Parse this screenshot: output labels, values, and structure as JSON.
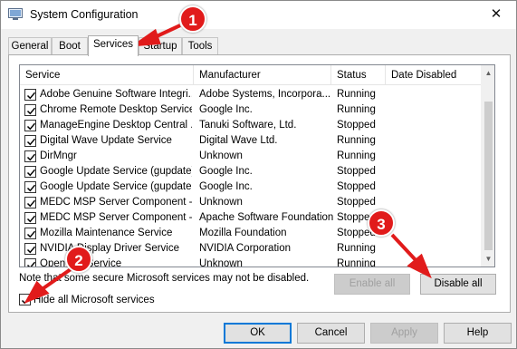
{
  "window": {
    "title": "System Configuration",
    "close_glyph": "✕"
  },
  "tabs": [
    {
      "label": "General"
    },
    {
      "label": "Boot"
    },
    {
      "label": "Services"
    },
    {
      "label": "Startup"
    },
    {
      "label": "Tools"
    }
  ],
  "active_tab": "Services",
  "columns": [
    "Service",
    "Manufacturer",
    "Status",
    "Date Disabled"
  ],
  "services": [
    {
      "name": "Adobe Genuine Software Integri...",
      "manufacturer": "Adobe Systems, Incorpora...",
      "status": "Running",
      "checked": true
    },
    {
      "name": "Chrome Remote Desktop Service",
      "manufacturer": "Google Inc.",
      "status": "Running",
      "checked": true
    },
    {
      "name": "ManageEngine Desktop Central ...",
      "manufacturer": "Tanuki Software, Ltd.",
      "status": "Stopped",
      "checked": true
    },
    {
      "name": "Digital Wave Update Service",
      "manufacturer": "Digital Wave Ltd.",
      "status": "Running",
      "checked": true
    },
    {
      "name": "DirMngr",
      "manufacturer": "Unknown",
      "status": "Running",
      "checked": true
    },
    {
      "name": "Google Update Service (gupdate)",
      "manufacturer": "Google Inc.",
      "status": "Stopped",
      "checked": true
    },
    {
      "name": "Google Update Service (gupdatem)",
      "manufacturer": "Google Inc.",
      "status": "Stopped",
      "checked": true
    },
    {
      "name": "MEDC MSP Server Component - ...",
      "manufacturer": "Unknown",
      "status": "Stopped",
      "checked": true
    },
    {
      "name": "MEDC MSP Server Component - ...",
      "manufacturer": "Apache Software Foundation",
      "status": "Stopped",
      "checked": true
    },
    {
      "name": "Mozilla Maintenance Service",
      "manufacturer": "Mozilla Foundation",
      "status": "Stopped",
      "checked": true
    },
    {
      "name": "NVIDIA Display Driver Service",
      "manufacturer": "NVIDIA Corporation",
      "status": "Running",
      "checked": true
    },
    {
      "name": "OpenVPNService",
      "manufacturer": "Unknown",
      "status": "Running",
      "checked": true
    }
  ],
  "note": "Note that some secure Microsoft services may not be disabled.",
  "buttons": {
    "enable_all": "Enable all",
    "disable_all": "Disable all",
    "ok": "OK",
    "cancel": "Cancel",
    "apply": "Apply",
    "help": "Help"
  },
  "hide_microsoft": {
    "label": "Hide all Microsoft services",
    "checked": true
  },
  "callouts": [
    "1",
    "2",
    "3"
  ],
  "colors": {
    "callout": "#e11b1b",
    "default_button_border": "#0078d7"
  }
}
